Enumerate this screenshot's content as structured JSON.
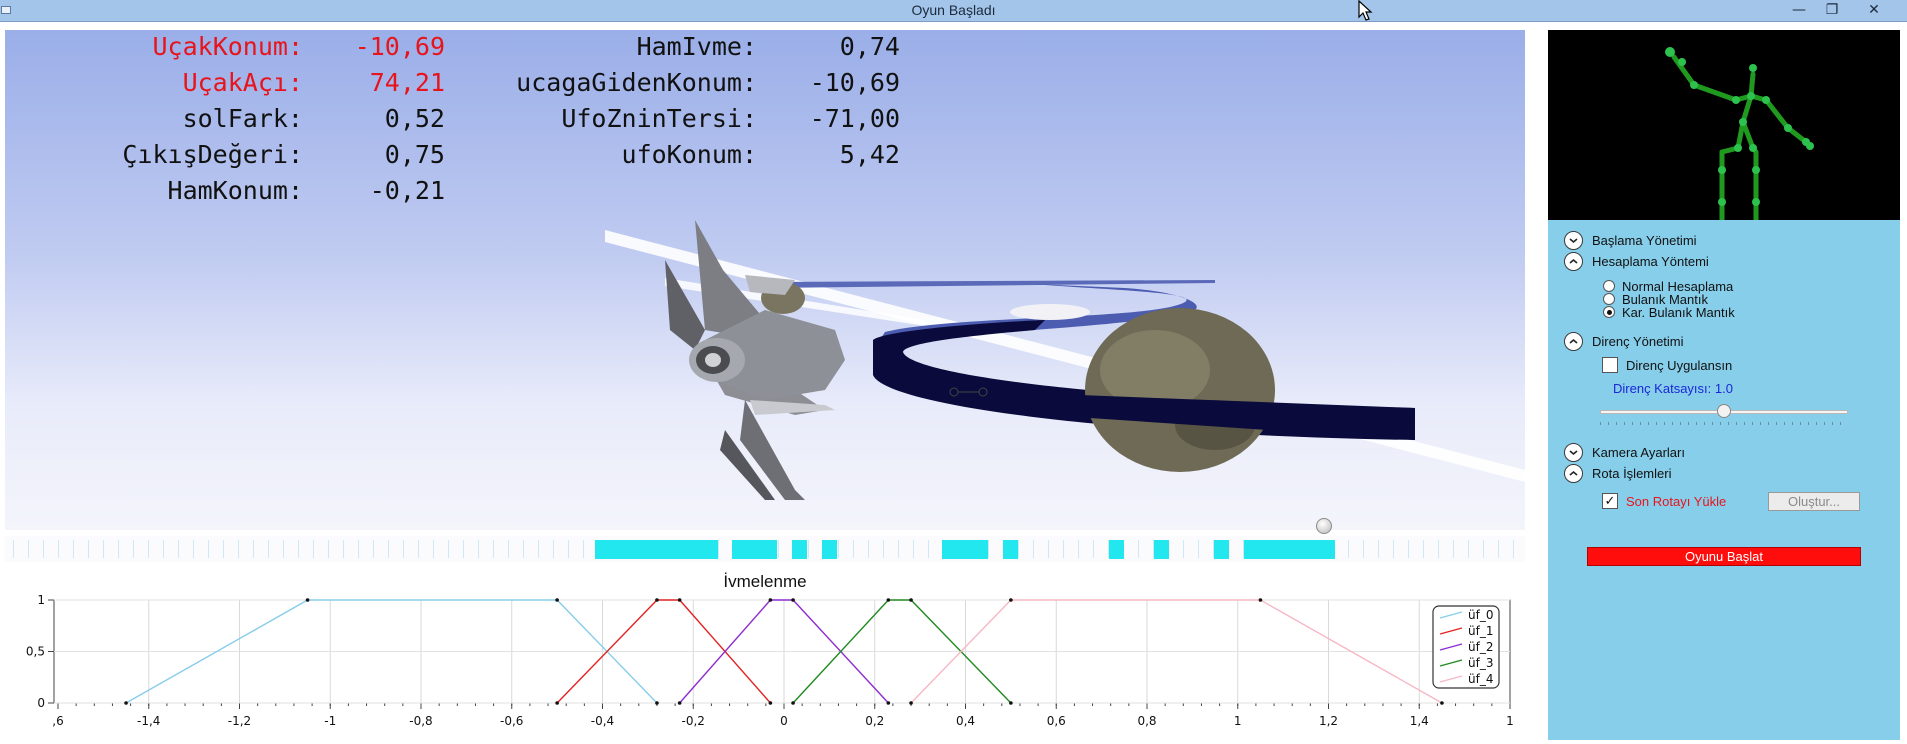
{
  "window": {
    "title": "Oyun Başladı",
    "minimize": "—",
    "maximize": "❐",
    "close": "✕"
  },
  "hud": {
    "left": [
      {
        "label": "UçakKonum:",
        "value": "-10,69",
        "color": "#e8141b"
      },
      {
        "label": "UçakAçı:",
        "value": "74,21",
        "color": "#e8141b"
      },
      {
        "label": "solFark:",
        "value": "0,52",
        "color": "#111111"
      },
      {
        "label": "ÇıkışDeğeri:",
        "value": "0,75",
        "color": "#111111"
      },
      {
        "label": "HamKonum:",
        "value": "-0,21",
        "color": "#111111"
      }
    ],
    "right": [
      {
        "label": "HamIvme:",
        "value": "0,74"
      },
      {
        "label": "ucagaGidenKonum:",
        "value": "-10,69"
      },
      {
        "label": "UfoZninTersi:",
        "value": "-71,00"
      },
      {
        "label": "ufoKonum:",
        "value": "5,42"
      }
    ]
  },
  "timeline": {
    "segments": [
      [
        590,
        713
      ],
      [
        727,
        772
      ],
      [
        787,
        802
      ],
      [
        817,
        832
      ],
      [
        937,
        983
      ],
      [
        998,
        1013
      ],
      [
        1104,
        1119
      ],
      [
        1149,
        1164
      ],
      [
        1209,
        1224
      ],
      [
        1239,
        1330
      ]
    ]
  },
  "chart_data": {
    "type": "line",
    "title": "İvmelenme",
    "xlim": [
      -1.6,
      1.0
    ],
    "ylim": [
      0,
      1
    ],
    "x_ticks": [
      ",6",
      "-1,4",
      "-1,2",
      "-1",
      "-0,8",
      "-0,6",
      "-0,4",
      "-0,2",
      "0",
      "0,2",
      "0,4",
      "0,6",
      "0,8",
      "1",
      "1,2",
      "1,4",
      "1"
    ],
    "y_ticks": [
      "0",
      "0,5",
      "1"
    ],
    "legend_position": "top-right",
    "series": [
      {
        "name": "üf_0",
        "color": "#87cdea",
        "x": [
          -1.45,
          -1.05,
          -0.5,
          -0.28
        ],
        "y": [
          0,
          1,
          1,
          0
        ]
      },
      {
        "name": "üf_1",
        "color": "#e32222",
        "x": [
          -0.5,
          -0.28,
          -0.23,
          -0.03
        ],
        "y": [
          0,
          1,
          1,
          0
        ]
      },
      {
        "name": "üf_2",
        "color": "#8e2cd0",
        "x": [
          -0.23,
          -0.03,
          0.02,
          0.23
        ],
        "y": [
          0,
          1,
          1,
          0
        ]
      },
      {
        "name": "üf_3",
        "color": "#1f8a1f",
        "x": [
          0.02,
          0.23,
          0.28,
          0.5
        ],
        "y": [
          0,
          1,
          1,
          0
        ]
      },
      {
        "name": "üf_4",
        "color": "#f7b7c4",
        "x": [
          0.28,
          0.5,
          1.05,
          1.45
        ],
        "y": [
          0,
          1,
          1,
          0
        ]
      }
    ]
  },
  "panel": {
    "sections": [
      {
        "label": "Başlama Yönetimi",
        "expanded": false
      },
      {
        "label": "Hesaplama Yöntemi",
        "expanded": true
      },
      {
        "label": "Direnç Yönetimi",
        "expanded": true
      },
      {
        "label": "Kamera Ayarları",
        "expanded": false
      },
      {
        "label": "Rota İşlemleri",
        "expanded": true
      }
    ],
    "radios": [
      {
        "label": "Normal Hesaplama",
        "selected": false
      },
      {
        "label": "Bulanık Mantık",
        "selected": false
      },
      {
        "label": "Kar. Bulanık Mantık",
        "selected": true
      }
    ],
    "direnc_check": {
      "label": "Direnç Uygulansın",
      "checked": false
    },
    "katsayi_label": "Direnç Katsayısı: 1.0",
    "slider_value": 0.5,
    "rota_check": {
      "label": "Son Rotayı Yükle",
      "checked": true,
      "mark": "✓"
    },
    "olustur_label": "Oluştur...",
    "start_label": "Oyunu Başlat"
  }
}
